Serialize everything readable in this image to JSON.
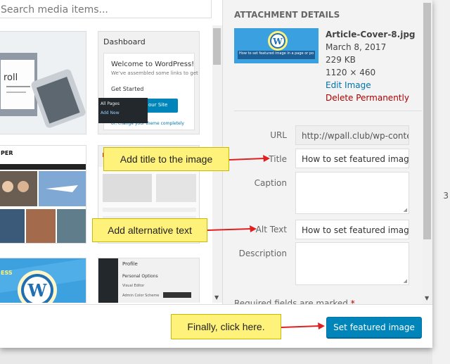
{
  "search": {
    "placeholder": "Search media items..."
  },
  "grid": {
    "thumb1": {
      "caption_big": "roll"
    },
    "thumb2": {
      "header": "Dashboard",
      "welcome": "Welcome to WordPress!",
      "sub": "We've assembled some links to get you",
      "get_started": "Get Started",
      "menu_item1": "All Pages",
      "menu_item2": "Add New",
      "btn_text": "our Site",
      "link_line": "or, change your theme completely"
    },
    "thumb3": {
      "logo": "PER"
    },
    "thumb5": {
      "logo": "ESS"
    },
    "thumb6": {
      "title": "Profile",
      "section": "Personal Options",
      "row1": "Visual Editor",
      "row2": "Admin Color Scheme"
    }
  },
  "details": {
    "heading": "ATTACHMENT DETAILS",
    "thumb_caption": "How to set featured image in a page or post",
    "filename": "Article-Cover-8.jpg",
    "date": "March 8, 2017",
    "size": "229 KB",
    "dimensions": "1120 × 460",
    "edit_link": "Edit Image",
    "delete_link": "Delete Permanently"
  },
  "fields": {
    "url_label": "URL",
    "url_value": "http://wpall.club/wp-conter",
    "title_label": "Title",
    "title_value": "How to set featured image",
    "caption_label": "Caption",
    "alt_label": "Alt Text",
    "alt_value": "How to set featured image",
    "description_label": "Description",
    "required_note": "Required fields are marked",
    "required_star": "*"
  },
  "footer": {
    "button_label": "Set featured image"
  },
  "callouts": {
    "title_note": "Add title to the image",
    "alt_note": "Add alternative text",
    "final_note": "Finally, click here."
  },
  "background": {
    "page_number": "3"
  },
  "colors": {
    "primary": "#0085ba",
    "callout": "#fff27a",
    "arrow": "#e02020",
    "link": "#0073aa",
    "danger": "#a00000"
  }
}
